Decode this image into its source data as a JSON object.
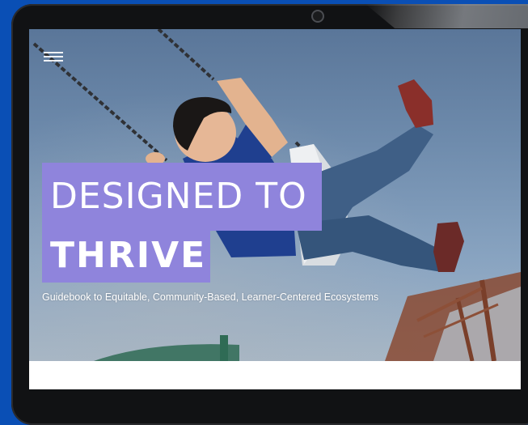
{
  "hero": {
    "title_line1": "DESIGNED TO",
    "title_line2": "THRIVE",
    "subtitle": "Guidebook to Equitable, Community-Based, Learner-Centered Ecosystems",
    "title_bg_color": "#8f84dc",
    "menu_icon": "hamburger-menu-icon"
  },
  "colors": {
    "page_background": "#0a4fb5",
    "device_bezel": "#111214"
  }
}
